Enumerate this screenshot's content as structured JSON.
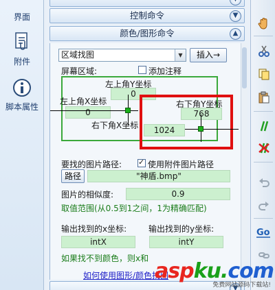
{
  "left_rail": {
    "items": [
      {
        "label": "界面",
        "icon": "interface-icon"
      },
      {
        "label": "附件",
        "icon": "attachment-icon"
      },
      {
        "label": "脚本属性",
        "icon": "info-icon"
      }
    ]
  },
  "main": {
    "sections": [
      {
        "label": "控制命令"
      },
      {
        "label": "颜色/图形命令"
      }
    ],
    "command_select": {
      "value": "区域找图"
    },
    "insert_button": "插入→",
    "region": {
      "label": "屏幕区域:",
      "add_comment_label": "添加注释",
      "top_left_y_label": "左上角Y坐标",
      "top_left_y_value": "0",
      "top_left_x_label": "左上角X坐标",
      "top_left_x_value": "0",
      "bottom_right_y_label": "右下角Y坐标",
      "bottom_right_y_value": "768",
      "bottom_right_x_label": "右下角X坐标",
      "bottom_right_x_value": "1024"
    },
    "image_path": {
      "label": "要找的图片路径:",
      "use_attachment_label": "使用附件图片路径",
      "path_button": "路径",
      "value": "\"神盾.bmp\""
    },
    "similarity": {
      "label": "图片的相似度:",
      "value": "0.9",
      "hint": "取值范围(从0.5到1之间，1为精确匹配)"
    },
    "output": {
      "x_label": "输出找到的x坐标:",
      "x_value": "intX",
      "y_label": "输出找到的y坐标:",
      "y_value": "intY"
    },
    "not_found_hint": "如果找不到颜色，则x和",
    "help_link": "如何使用图形/颜色找图"
  },
  "watermark": {
    "brand_letters": [
      "a",
      "s",
      "p",
      "k",
      "u",
      ".",
      "c",
      "o",
      "m"
    ],
    "brand_colors": [
      "#e8261f",
      "#e8261f",
      "#e8261f",
      "#1aa11a",
      "#1aa11a",
      "#1aa11a",
      "#1f5fd0",
      "#1f5fd0",
      "#1f5fd0"
    ],
    "subtitle": "免费网站源码下载站!"
  },
  "colors": {
    "highlight_red": "#e01010",
    "field_green": "#ccf0cf",
    "hint_green": "#1b7d1b"
  }
}
